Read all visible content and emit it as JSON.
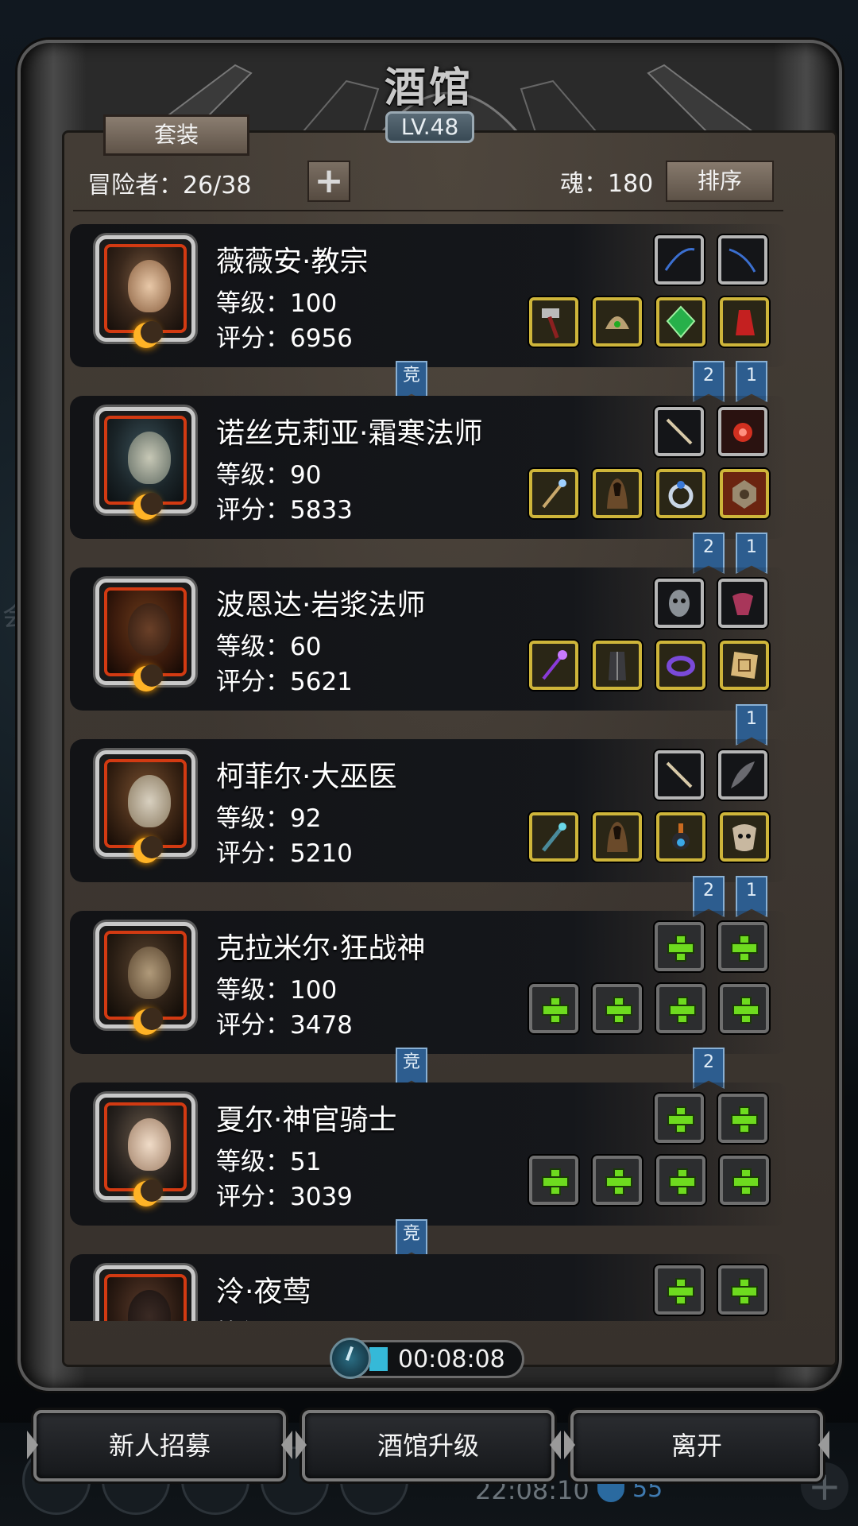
{
  "background": {
    "side_text": "会",
    "clock": "22:08:10",
    "shield_value": "55"
  },
  "window": {
    "title": "酒馆",
    "level": "LV.48"
  },
  "toolbar": {
    "set_button": "套装",
    "adventurer_label": "冒险者：26/38",
    "add_button": "+",
    "soul_label": "魂：180",
    "sort_button": "排序"
  },
  "heroes": [
    {
      "name": "薇薇安·教宗",
      "level": "等级：100",
      "score": "评分：6956",
      "tags_left": [
        "竞"
      ],
      "tags_right": [
        "2",
        "1"
      ]
    },
    {
      "name": "诺丝克莉亚·霜寒法师",
      "level": "等级：90",
      "score": "评分：5833",
      "tags_left": [],
      "tags_right": [
        "2",
        "1"
      ]
    },
    {
      "name": "波恩达·岩浆法师",
      "level": "等级：60",
      "score": "评分：5621",
      "tags_left": [],
      "tags_right": [
        "1"
      ]
    },
    {
      "name": "柯菲尔·大巫医",
      "level": "等级：92",
      "score": "评分：5210",
      "tags_left": [],
      "tags_right": [
        "2",
        "1"
      ]
    },
    {
      "name": "克拉米尔·狂战神",
      "level": "等级：100",
      "score": "评分：3478",
      "tags_left": [
        "竞"
      ],
      "tags_right": [
        "2"
      ]
    },
    {
      "name": "夏尔·神官骑士",
      "level": "等级：51",
      "score": "评分：3039",
      "tags_left": [
        "竞"
      ],
      "tags_right": []
    },
    {
      "name": "泠·夜莺",
      "level": "等级：",
      "score": "",
      "tags_left": [],
      "tags_right": []
    }
  ],
  "timer": {
    "value": "00:08:08",
    "progress": 0.12
  },
  "buttons": {
    "recruit": "新人招募",
    "upgrade": "酒馆升级",
    "leave": "离开"
  }
}
